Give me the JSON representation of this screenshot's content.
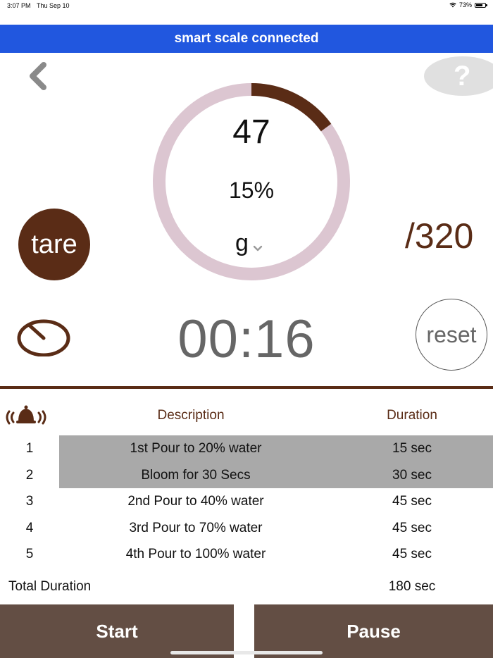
{
  "status_bar": {
    "time": "3:07 PM",
    "date": "Thu Sep 10",
    "battery": "73%"
  },
  "banner": {
    "text": "smart scale connected"
  },
  "help": {
    "label": "?"
  },
  "scale": {
    "weight": "47",
    "percent_text": "15%",
    "progress": 0.15,
    "unit": "g",
    "target": "/320",
    "tare_label": "tare"
  },
  "timer": {
    "elapsed": "00:16",
    "reset_label": "reset"
  },
  "table": {
    "headers": {
      "description": "Description",
      "duration": "Duration"
    },
    "rows": [
      {
        "num": "1",
        "description": "1st Pour to 20% water",
        "duration": "15 sec",
        "active": true
      },
      {
        "num": "2",
        "description": "Bloom for 30 Secs",
        "duration": "30 sec",
        "active": true
      },
      {
        "num": "3",
        "description": "2nd Pour to 40% water",
        "duration": "45 sec",
        "active": false
      },
      {
        "num": "4",
        "description": "3rd Pour to 70% water",
        "duration": "45 sec",
        "active": false
      },
      {
        "num": "5",
        "description": "4th Pour to 100% water",
        "duration": "45 sec",
        "active": false
      }
    ],
    "total_label": "Total Duration",
    "total_value": "180 sec"
  },
  "controls": {
    "start_label": "Start",
    "pause_label": "Pause"
  },
  "colors": {
    "banner": "#2157df",
    "brown": "#5a2c16",
    "ring_track": "#dcc6d1",
    "ring_progress": "#5a2c16",
    "button_bg": "#634e44",
    "row_highlight": "#a9a9a9"
  }
}
